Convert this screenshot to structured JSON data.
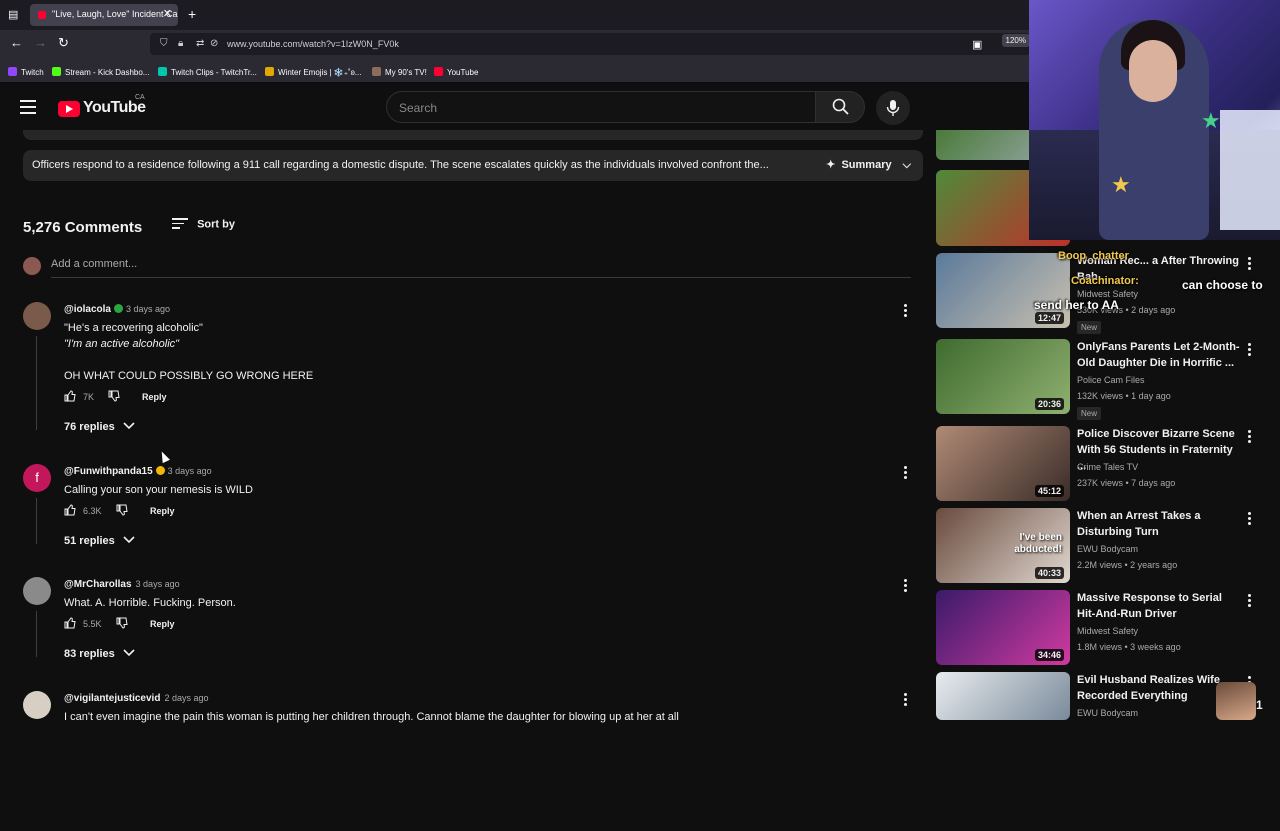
{
  "browser": {
    "tab_title": "\"Live, Laugh, Love\" Incident Ca",
    "url": "www.youtube.com/watch?v=1IzW0N_FV0k",
    "zoom": "120%",
    "bookmarks": [
      {
        "label": "Twitch",
        "color": "#9146ff"
      },
      {
        "label": "Stream - Kick Dashbo...",
        "color": "#53fc18"
      },
      {
        "label": "Twitch Clips - TwitchTr...",
        "color": "#00c8af"
      },
      {
        "label": "Winter Emojis | ❄️₊˚ʚ...",
        "color": "#e0a800"
      },
      {
        "label": "My 90's TV!",
        "color": "#8a6d5a"
      },
      {
        "label": "YouTube",
        "color": "#ff0033"
      }
    ]
  },
  "header": {
    "logo_text": "YouTube",
    "country_code": "CA",
    "search_placeholder": "Search"
  },
  "summary": {
    "text": "Officers respond to a residence following a 911 call regarding a domestic dispute. The scene escalates quickly as the individuals involved confront the...",
    "button_label": "Summary"
  },
  "comments_section": {
    "count_label": "5,276 Comments",
    "sort_label": "Sort by",
    "add_placeholder": "Add a comment..."
  },
  "comments": [
    {
      "author": "@iolacola",
      "time": "3 days ago",
      "badge_color": "#2ba640",
      "avatar_color": "#7a5a4a",
      "lines": [
        "\"He's a recovering alcoholic\"",
        "\"I'm an active alcoholic\"",
        "",
        "OH WHAT COULD POSSIBLY GO WRONG HERE"
      ],
      "likes": "7K",
      "reply_label": "Reply",
      "replies_label": "76 replies"
    },
    {
      "author": "@Funwithpanda15",
      "time": "3 days ago",
      "badge_color": "#f2b705",
      "avatar_color": "#c2185b",
      "avatar_letter": "f",
      "lines": [
        "Calling your son your nemesis is WILD"
      ],
      "likes": "6.3K",
      "reply_label": "Reply",
      "replies_label": "51 replies"
    },
    {
      "author": "@MrCharollas",
      "time": "3 days ago",
      "avatar_color": "#8a8a8a",
      "lines": [
        "What. A. Horrible. Fucking. Person."
      ],
      "likes": "5.5K",
      "reply_label": "Reply",
      "replies_label": "83 replies"
    },
    {
      "author": "@vigilantejusticevid",
      "time": "2 days ago",
      "avatar_color": "#d8cfc4",
      "lines": [
        "I can't even imagine the pain this woman is putting her children through. Cannot blame the daughter for blowing up at her at all"
      ]
    }
  ],
  "sidebar": [
    {
      "title": "Woman Rec... a After Throwing Bab...",
      "channel": "Midwest Safety",
      "meta": "530K views • 2 days ago",
      "duration": "12:47",
      "badge": "New",
      "thumb": [
        "#5a7a9a",
        "#c9c0b0"
      ]
    },
    {
      "title": "OnlyFans Parents Let 2-Month-Old Daughter Die in Horrific ...",
      "channel": "Police Cam Files",
      "meta": "132K views • 1 day ago",
      "duration": "20:36",
      "badge": "New",
      "thumb": [
        "#3f6b2f",
        "#8fb070"
      ]
    },
    {
      "title": "Police Discover Bizarre Scene With 56 Students in Fraternity ...",
      "channel": "Crime Tales TV",
      "meta": "237K views • 7 days ago",
      "duration": "45:12",
      "thumb": [
        "#b08a76",
        "#3a2c28"
      ]
    },
    {
      "title": "When an Arrest Takes a Disturbing Turn",
      "channel": "EWU Bodycam",
      "meta": "2.2M views • 2 years ago",
      "duration": "40:33",
      "overlay": "I've been abducted!",
      "thumb": [
        "#6a4a3e",
        "#e0d8d0"
      ]
    },
    {
      "title": "Massive Response to Serial Hit-And-Run Driver",
      "channel": "Midwest Safety",
      "meta": "1.8M views • 3 weeks ago",
      "duration": "34:46",
      "thumb": [
        "#3a1a6a",
        "#d03aa0"
      ]
    },
    {
      "title": "Evil Husband Realizes Wife Recorded Everything",
      "channel": "EWU Bodycam",
      "meta": "",
      "duration": "",
      "thumb": [
        "#e8ecef",
        "#7a8a9a"
      ]
    }
  ],
  "top_thumbs": [
    [
      "#4a7a3a",
      "#9aa"
    ],
    [
      "#4f8a3a",
      "#c0302a"
    ]
  ],
  "stream_overlay": {
    "chat_user_1": "Boop_chatter",
    "chat_user_2": "Coachinator:",
    "chat_message": "can choose to send her to AA",
    "corner_count": "1"
  }
}
